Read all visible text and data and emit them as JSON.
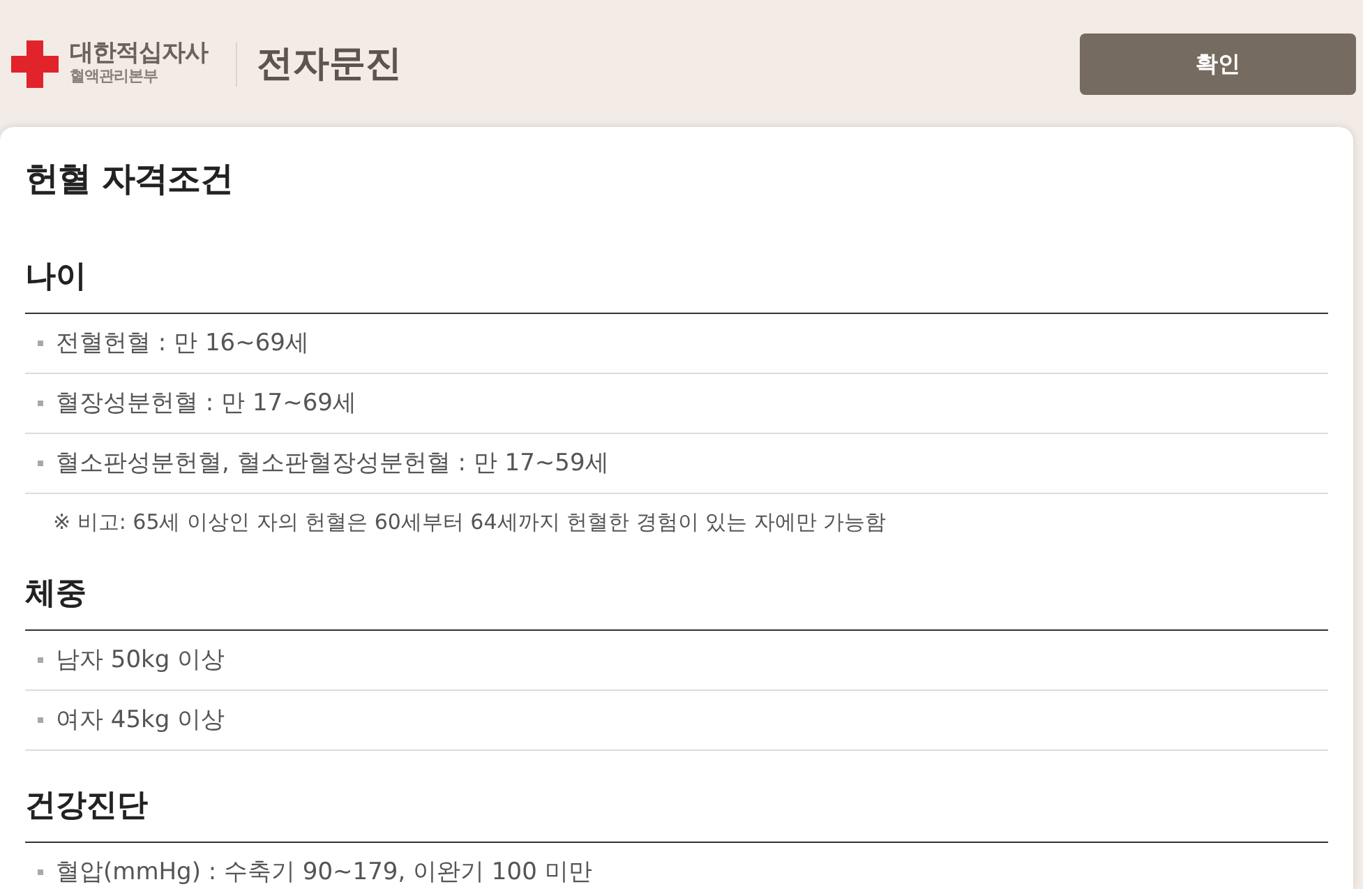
{
  "header": {
    "logo": {
      "name": "대한적십자사",
      "subtitle": "혈액관리본부"
    },
    "title": "전자문진",
    "confirm_button": "확인"
  },
  "content": {
    "title": "헌혈 자격조건",
    "sections": [
      {
        "heading": "나이",
        "items": [
          {
            "kind": "bullet",
            "text": "전혈헌혈 : 만 16~69세"
          },
          {
            "kind": "bullet",
            "text": "혈장성분헌혈 : 만 17~69세"
          },
          {
            "kind": "bullet",
            "text": "혈소판성분헌혈, 혈소판혈장성분헌혈 : 만 17~59세"
          },
          {
            "kind": "note",
            "text": "※ 비고: 65세 이상인 자의 헌혈은 60세부터 64세까지 헌혈한 경험이 있는 자에만 가능함"
          }
        ]
      },
      {
        "heading": "체중",
        "items": [
          {
            "kind": "bullet",
            "text": "남자 50kg 이상"
          },
          {
            "kind": "bullet",
            "text": "여자 45kg 이상"
          }
        ]
      },
      {
        "heading": "건강진단",
        "items": [
          {
            "kind": "bullet",
            "text": "혈압(mmHg) : 수축기 90~179, 이완기 100 미만"
          }
        ]
      }
    ]
  }
}
